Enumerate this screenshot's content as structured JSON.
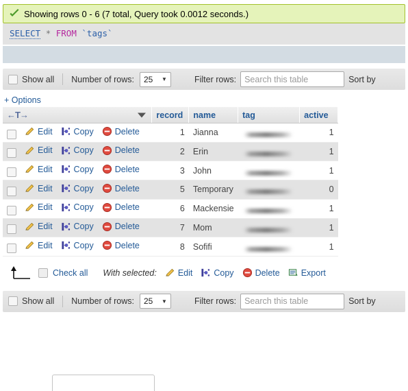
{
  "result_message": {
    "icon": "green-check-icon",
    "text": "Showing rows 0 - 6 (7 total, Query took 0.0012 seconds.)"
  },
  "sql_query": {
    "keyword_select": "SELECT",
    "star": "*",
    "keyword_from": "FROM",
    "table_ref": "`tags`"
  },
  "toolbar": {
    "show_all_label": "Show all",
    "number_of_rows_label": "Number of rows:",
    "number_of_rows_value": "25",
    "caret": "▼",
    "filter_rows_label": "Filter rows:",
    "filter_rows_placeholder": "Search this table",
    "sort_by_label": "Sort by"
  },
  "options_link": "+ Options",
  "table": {
    "nav_icon_label": "←T→",
    "columns": [
      "record",
      "name",
      "tag",
      "active"
    ],
    "row_actions": {
      "edit": "Edit",
      "copy": "Copy",
      "delete": "Delete"
    },
    "rows": [
      {
        "record": "1",
        "name": "Jianna",
        "tag": "",
        "active": "1"
      },
      {
        "record": "2",
        "name": "Erin",
        "tag": "",
        "active": "1"
      },
      {
        "record": "3",
        "name": "John",
        "tag": "",
        "active": "1"
      },
      {
        "record": "5",
        "name": "Temporary",
        "tag": "",
        "active": "0"
      },
      {
        "record": "6",
        "name": "Mackensie",
        "tag": "",
        "active": "1"
      },
      {
        "record": "7",
        "name": "Mom",
        "tag": "",
        "active": "1"
      },
      {
        "record": "8",
        "name": "Sofifi",
        "tag": "",
        "active": "1"
      }
    ]
  },
  "selected_bar": {
    "check_all_label": "Check all",
    "with_selected_label": "With selected:",
    "edit": "Edit",
    "copy": "Copy",
    "delete": "Delete",
    "export": "Export"
  },
  "colors": {
    "success_bg": "#e5f3ba",
    "success_border": "#a2c12a",
    "link_blue": "#235a97",
    "sql_keyword_purple": "#b5289e",
    "row_alt_bg": "#e3e3e3",
    "action_band": "#d3dce3"
  }
}
